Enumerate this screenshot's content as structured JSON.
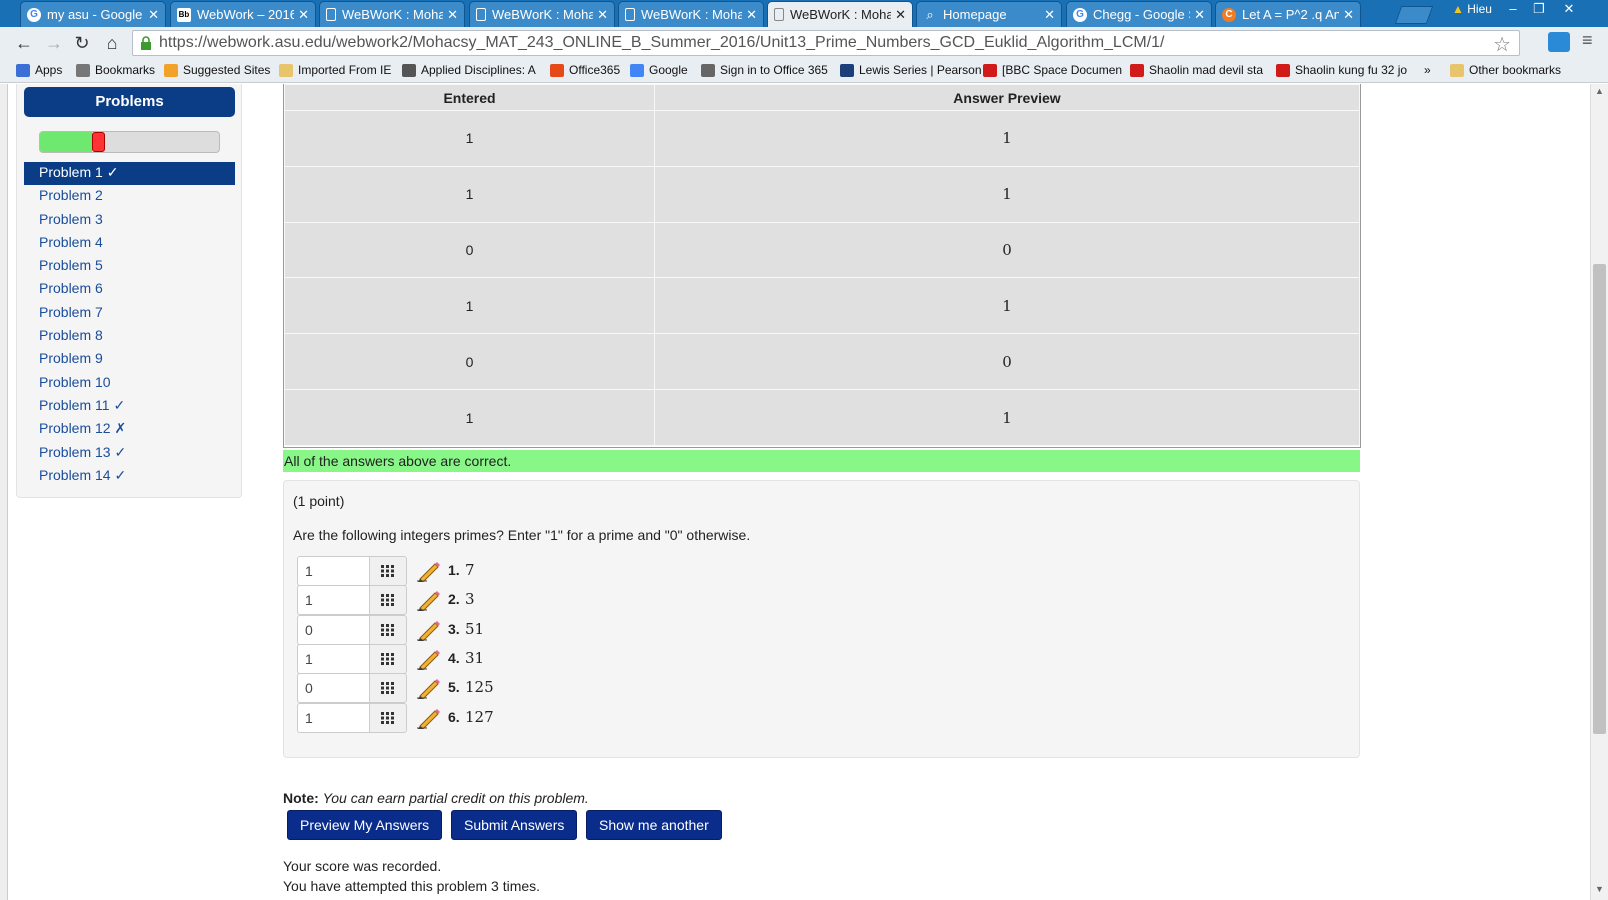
{
  "browser": {
    "tabs": [
      {
        "title": "my asu - Google S",
        "icon": "google-icon"
      },
      {
        "title": "WebWork – 2016S",
        "icon": "blackboard-icon"
      },
      {
        "title": "WeBWorK : Moha",
        "icon": "page-icon"
      },
      {
        "title": "WeBWorK : Moha",
        "icon": "page-icon"
      },
      {
        "title": "WeBWorK : Moha",
        "icon": "page-icon"
      },
      {
        "title": "WeBWorK : Moha",
        "icon": "page-icon"
      },
      {
        "title": "Homepage",
        "icon": "search-icon"
      },
      {
        "title": "Chegg - Google S",
        "icon": "google-icon"
      },
      {
        "title": "Let A = P^2 .q An",
        "icon": "chegg-icon"
      }
    ],
    "profile_name": "Hieu",
    "url": "https://webwork.asu.edu/webwork2/Mohacsy_MAT_243_ONLINE_B_Summer_2016/Unit13_Prime_Numbers_GCD_Euklid_Algorithm_LCM/1/",
    "bookmarks": [
      {
        "label": "Apps",
        "color": "#3b6fd6"
      },
      {
        "label": "Bookmarks",
        "color": "#777777"
      },
      {
        "label": "Suggested Sites",
        "color": "#f2a12b"
      },
      {
        "label": "Imported From IE",
        "color": "#e8c56a"
      },
      {
        "label": "Applied Disciplines: A",
        "color": "#555555"
      },
      {
        "label": "Office365",
        "color": "#e64a19"
      },
      {
        "label": "Google",
        "color": "#4285f4"
      },
      {
        "label": "Sign in to Office 365",
        "color": "#666666"
      },
      {
        "label": "Lewis Series | Pearson",
        "color": "#1a3f7a"
      },
      {
        "label": "[BBC Space Documen",
        "color": "#d11a1a"
      },
      {
        "label": "Shaolin mad devil sta",
        "color": "#d11a1a"
      },
      {
        "label": "Shaolin kung fu 32 jo",
        "color": "#d11a1a"
      },
      {
        "label": "»",
        "color": ""
      },
      {
        "label": "Other bookmarks",
        "color": "#e8c56a"
      }
    ]
  },
  "sidebar": {
    "title": "Problems",
    "progress": {
      "correct_fraction": 0.29,
      "incorrect_fraction": 0.07
    },
    "problems": [
      {
        "label": "Problem 1 ✓",
        "active": true
      },
      {
        "label": "Problem 2"
      },
      {
        "label": "Problem 3"
      },
      {
        "label": "Problem 4"
      },
      {
        "label": "Problem 5"
      },
      {
        "label": "Problem 6"
      },
      {
        "label": "Problem 7"
      },
      {
        "label": "Problem 8"
      },
      {
        "label": "Problem 9"
      },
      {
        "label": "Problem 10"
      },
      {
        "label": "Problem 11 ✓"
      },
      {
        "label": "Problem 12 ✗"
      },
      {
        "label": "Problem 13 ✓"
      },
      {
        "label": "Problem 14 ✓"
      }
    ]
  },
  "results": {
    "headers": [
      "Entered",
      "Answer Preview"
    ],
    "rows": [
      [
        "1",
        "1"
      ],
      [
        "1",
        "1"
      ],
      [
        "0",
        "0"
      ],
      [
        "1",
        "1"
      ],
      [
        "0",
        "0"
      ],
      [
        "1",
        "1"
      ]
    ],
    "message": "All of the answers above are correct."
  },
  "problem": {
    "points": "(1 point)",
    "question": "Are the following integers primes? Enter \"1\" for a prime and \"0\" otherwise.",
    "items": [
      {
        "answer": "1",
        "num": "1.",
        "value": "7"
      },
      {
        "answer": "1",
        "num": "2.",
        "value": "3"
      },
      {
        "answer": "0",
        "num": "3.",
        "value": "51"
      },
      {
        "answer": "1",
        "num": "4.",
        "value": "31"
      },
      {
        "answer": "0",
        "num": "5.",
        "value": "125"
      },
      {
        "answer": "1",
        "num": "6.",
        "value": "127"
      }
    ]
  },
  "note": {
    "label": "Note:",
    "text": "You can earn partial credit on this problem."
  },
  "buttons": {
    "preview": "Preview My Answers",
    "submit": "Submit Answers",
    "another": "Show me another"
  },
  "status": {
    "score": "Your score was recorded.",
    "attempts": "You have attempted this problem 3 times."
  }
}
